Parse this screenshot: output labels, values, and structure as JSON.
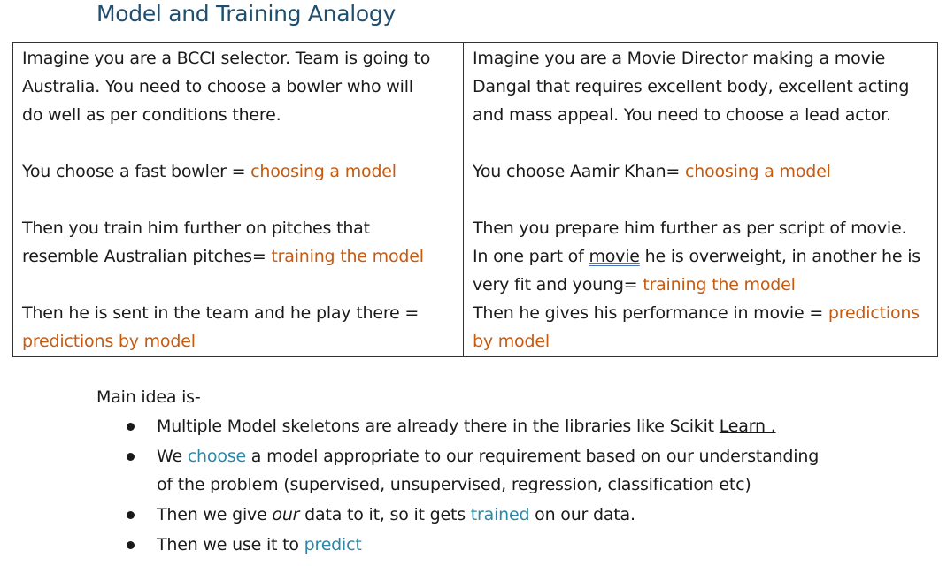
{
  "title": "Model and Training Analogy",
  "left_cell": {
    "p1_lines": [
      "Imagine you are a BCCI selector.  Team is going to",
      "Australia. You need to choose a bowler who will",
      "do well as per conditions there."
    ],
    "p2_text": "You choose a fast bowler = ",
    "p2_highlight": "choosing a model",
    "p3_line1": "Then you train him further on pitches that",
    "p3_line2_text": "resemble Australian pitches= ",
    "p3_highlight": "training the model",
    "p4_line1": "Then he is sent in the team and he play there =",
    "p4_highlight": "predictions by model"
  },
  "right_cell": {
    "p1_lines": [
      "Imagine you are a Movie Director making a movie",
      "Dangal that requires excellent body, excellent acting",
      "and mass appeal.  You need to choose a lead actor."
    ],
    "p2_text": "You choose Aamir Khan= ",
    "p2_highlight": "choosing a model",
    "p3_line1": "Then you prepare him further as per script of movie.",
    "p3_line2_pre": "In one part of ",
    "p3_line2_link": "movie",
    "p3_line2_post": " he is overweight, in another he is",
    "p3_line3_text": "very fit and young= ",
    "p3_highlight": "training the model",
    "p4_text": "Then he gives his performance in movie = ",
    "p4_highlight_a": "predictions",
    "p4_highlight_b": "by model"
  },
  "main_idea": {
    "heading": "Main idea is-",
    "bullets": [
      {
        "pre": "Multiple Model skeletons are already there in the libraries like Scikit ",
        "link": "Learn ."
      },
      {
        "pre": "We ",
        "highlight": "choose",
        "post": " a model appropriate to our requirement based on our understanding",
        "line2": "of the problem (supervised, unsupervised, regression, classification etc)"
      },
      {
        "pre": "Then we give ",
        "italic": "our",
        "mid": " data to it, so it gets ",
        "highlight": "trained",
        "post": " on our data."
      },
      {
        "pre": "Then we use it to ",
        "highlight": "predict"
      }
    ]
  },
  "colors": {
    "title": "#1f4e6e",
    "orange": "#c55a11",
    "teal": "#2e86a6"
  }
}
